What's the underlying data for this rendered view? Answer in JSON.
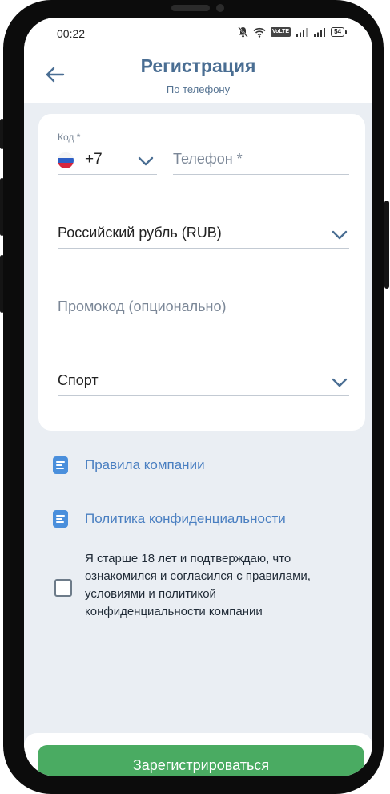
{
  "status": {
    "time": "00:22",
    "volte": "VoLTE",
    "battery": "54"
  },
  "header": {
    "title": "Регистрация",
    "subtitle": "По телефону"
  },
  "form": {
    "code_label": "Код *",
    "code_value": "+7",
    "phone_placeholder": "Телефон *",
    "currency_value": "Российский рубль (RUB)",
    "promo_placeholder": "Промокод (опционально)",
    "bonus_value": "Спорт"
  },
  "links": {
    "rules": "Правила компании",
    "privacy": "Политика конфиденциальности"
  },
  "agreement": {
    "text": "Я старше 18 лет и подтверждаю, что ознакомился и согласился с правилами, условиями и политикой конфиденциальности компании"
  },
  "actions": {
    "register": "Зарегистрироваться"
  },
  "colors": {
    "accent": "#4a6e93",
    "link": "#4a7fc1",
    "button": "#4aab62",
    "background": "#eaeef3"
  }
}
